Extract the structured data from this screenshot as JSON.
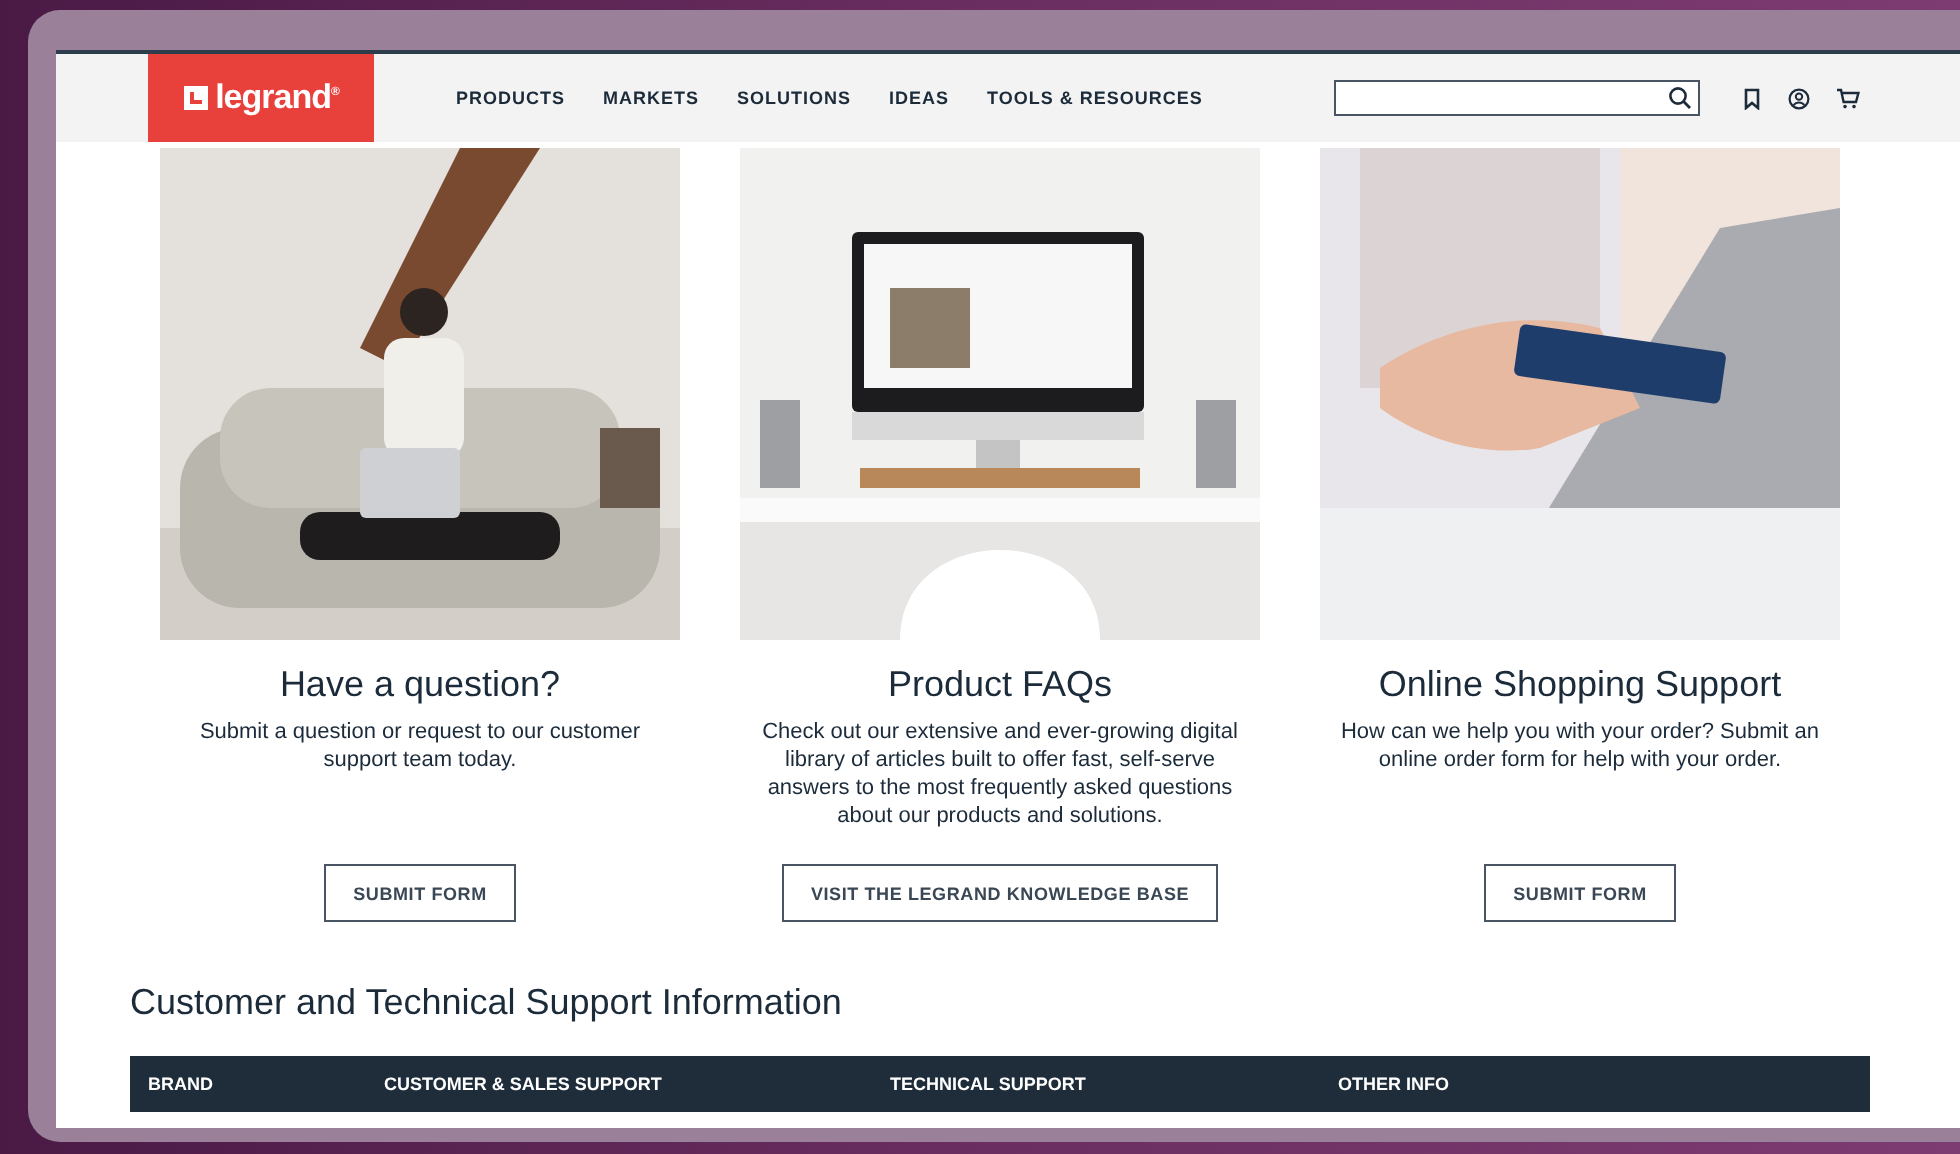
{
  "header": {
    "logo": "legrand$^{®}$",
    "nav": [
      "PRODUCTS",
      "MARKETS",
      "SOLUTIONS",
      "IDEAS",
      "TOOLS & RESOURCES"
    ]
  },
  "cards": [
    {
      "kind": "person",
      "title": "Have a question?",
      "text": "Submit a question or request to our customer support team today.",
      "button": "SUBMIT FORM"
    },
    {
      "kind": "desk",
      "title": "Product FAQs",
      "text": "Check out our extensive and ever-growing digital library of articles built to offer fast, self-serve answers to the most frequently asked questions about our products and solutions.",
      "button": "VISIT THE LEGRAND KNOWLEDGE BASE"
    },
    {
      "kind": "card",
      "title": "Online Shopping Support",
      "text": "How can we help you with your order? Submit an online order form for help with your order.",
      "button": "SUBMIT FORM"
    }
  ],
  "section": {
    "title": "Customer and Technical Support Information",
    "columns": [
      "BRAND",
      "CUSTOMER & SALES SUPPORT",
      "TECHNICAL SUPPORT",
      "OTHER INFO"
    ]
  }
}
